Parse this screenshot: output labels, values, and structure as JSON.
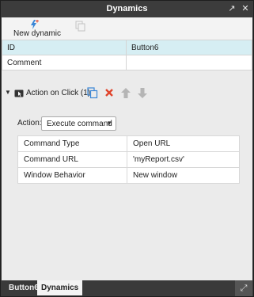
{
  "window": {
    "title": "Dynamics",
    "popout_icon": "popout-icon",
    "close_icon": "close-icon"
  },
  "toolbar": {
    "new_dynamic_label": "New dynamic",
    "new_dynamic_icon": "lightning-plus-icon",
    "copy_icon": "copy-icon"
  },
  "properties": [
    {
      "key": "ID",
      "value": "Button6"
    },
    {
      "key": "Comment",
      "value": ""
    }
  ],
  "action": {
    "header_label": "Action on Click (1)",
    "expanded": true,
    "field_label": "Action:",
    "selected": "Execute command",
    "buttons": [
      "copy-icon",
      "delete-icon",
      "move-up-icon",
      "move-down-icon"
    ],
    "colors": {
      "delete": "#e0442b",
      "copy": "#3a86d6",
      "arrows": "#b5b5b5"
    }
  },
  "command": [
    {
      "key": "Command Type",
      "value": "Open URL"
    },
    {
      "key": "Command URL",
      "value": "'myReport.csv'"
    },
    {
      "key": "Window Behavior",
      "value": "New window"
    }
  ],
  "bottom_tabs": [
    {
      "label": "Button6",
      "active": false
    },
    {
      "label": "Dynamics",
      "active": true
    }
  ],
  "resize_icon": "expand-icon"
}
